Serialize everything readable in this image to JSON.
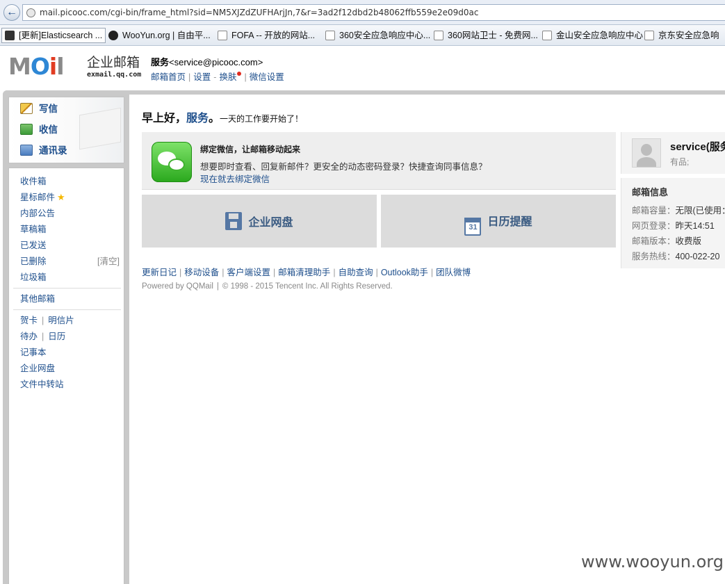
{
  "browser": {
    "url": "mail.picooc.com/cgi-bin/frame_html?sid=NM5XJZdZUFHArjJn,7&r=3ad2f12dbd2b48062ffb559e2e09d0ac",
    "bookmarks": [
      "[更新]Elasticsearch ...",
      "WooYun.org | 自由平...",
      "FOFA -- 开放的网站...",
      "360安全应急响应中心...",
      "360网站卫士 - 免费网...",
      "金山安全应急响应中心",
      "京东安全应急响"
    ]
  },
  "header": {
    "logo_text": "MOil",
    "logo_cn": "企业邮箱",
    "logo_domain": "exmail.qq.com",
    "account_name": "服务",
    "account_email": "<service@picooc.com>",
    "links": [
      "邮箱首页",
      "设置",
      "换肤",
      "微信设置"
    ],
    "link_sep_dash": "-"
  },
  "sidebar": {
    "quick": [
      "写信",
      "收信",
      "通讯录"
    ],
    "folders": {
      "inbox": "收件箱",
      "starred": "星标邮件",
      "star": "★",
      "notice": "内部公告",
      "drafts": "草稿箱",
      "sent": "已发送",
      "deleted": "已删除",
      "clear": "[清空]",
      "spam": "垃圾箱",
      "other": "其他邮箱",
      "card": "贺卡",
      "postcard": "明信片",
      "todo": "待办",
      "calendar": "日历",
      "notes": "记事本",
      "disk": "企业网盘",
      "transfer": "文件中转站",
      "sep": "|"
    }
  },
  "main": {
    "greeting": "早上好，",
    "greeting_name": "服务",
    "greeting_dot": "。",
    "greeting_sub": "一天的工作要开始了！",
    "wechat": {
      "title": "绑定微信，让邮箱移动起来",
      "desc": "想要即时查看、回复新邮件？更安全的动态密码登录？快捷查询同事信息？",
      "link": "现在就去绑定微信"
    },
    "tiles": {
      "disk": "企业网盘",
      "calendar": "日历提醒",
      "calendar_day": "31"
    },
    "footer_links": [
      "更新日记",
      "移动设备",
      "客户端设置",
      "邮箱清理助手",
      "自助查询",
      "Outlook助手",
      "团队微博"
    ],
    "powered_by": "Powered by QQMail",
    "copyright": "© 1998 - 2015 Tencent Inc. All Rights Reserved."
  },
  "right": {
    "name": "service(服务",
    "sub": "有品;",
    "info_title": "邮箱信息",
    "rows": [
      {
        "label": "邮箱容量：",
        "value": "无限(已使用："
      },
      {
        "label": "网页登录：",
        "value": "昨天14:51"
      },
      {
        "label": "邮箱版本：",
        "value": "收费版"
      },
      {
        "label": "服务热线：",
        "value": "400-022-20"
      }
    ]
  },
  "watermark": "www.wooyun.org"
}
